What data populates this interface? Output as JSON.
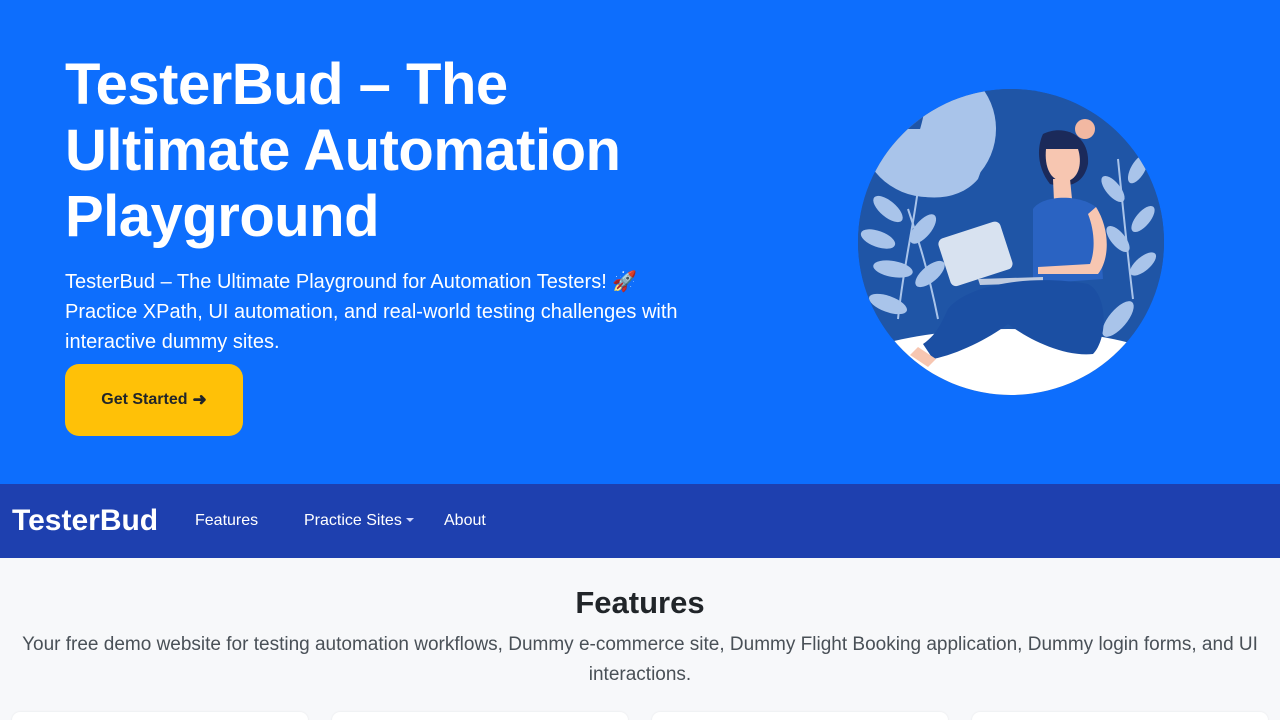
{
  "hero": {
    "title": "TesterBud – The Ultimate Automation Playground",
    "subtitle": "TesterBud – The Ultimate Playground for Automation Testers! 🚀 Practice XPath, UI automation, and real-world testing challenges with interactive dummy sites.",
    "cta_label": "Get Started",
    "cta_icon": "arrow-right-icon"
  },
  "navbar": {
    "brand": "TesterBud",
    "links": [
      "Features",
      "Practice Sites",
      "About"
    ]
  },
  "features": {
    "heading": "Features",
    "description": "Your free demo website for testing automation workflows, Dummy e-commerce site, Dummy Flight Booking application, Dummy login forms, and UI interactions."
  },
  "colors": {
    "hero_bg": "#0d6efd",
    "navbar_bg": "#1e40af",
    "cta_bg": "#ffc107"
  }
}
